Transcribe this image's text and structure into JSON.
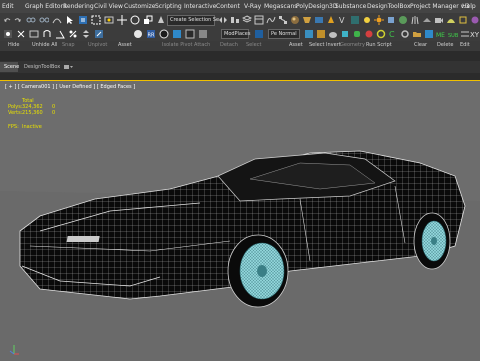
{
  "menu": [
    "Edit",
    "Graph Editors",
    "Rendering",
    "Civil View",
    "Customize",
    "Scripting",
    "Interactive",
    "Content",
    "V-Ray",
    "Megascans",
    "PolyDesign3D",
    "Substance",
    "DesignToolBox",
    "Project Manager v.3",
    "Help"
  ],
  "toolbar": {
    "selection_set_placeholder": "Create Selection Se",
    "modifier_label": "ModPlaces",
    "mode_label": "Pe Normal",
    "labels": [
      "Hide",
      "Unhide All",
      "Snap",
      "Unpivot",
      "Asset",
      "Isolate Pivot",
      "Attach",
      "Detach",
      "Select",
      "Asset",
      "Select Invert",
      "Geometry",
      "Run Script",
      "Clear",
      "Delete",
      "Edit"
    ]
  },
  "tabs": [
    "Scene",
    "DesignToolBox"
  ],
  "viewport": {
    "label": "[ + ] [ Camera001 ] [ User Defined ] [ Edged Faces ]",
    "stats": {
      "header": "Total",
      "rows": [
        {
          "label": "Polys:",
          "value": "324,362",
          "extra": "0"
        },
        {
          "label": "Verts:",
          "value": "215,360",
          "extra": "0"
        }
      ],
      "fps_label": "FPS:",
      "fps_value": "Inactive"
    }
  },
  "colors": {
    "accent_yellow": "#e8e000",
    "teal": "#8fd3d8",
    "toolbar_bg": "#3c3c3c",
    "viewport_bg": "#6d6d6d"
  }
}
